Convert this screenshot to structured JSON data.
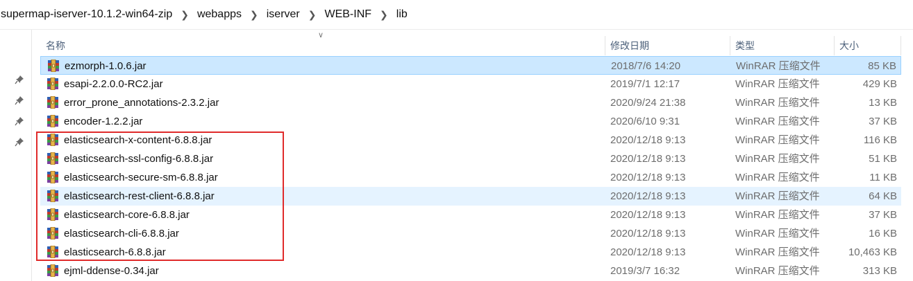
{
  "breadcrumb": [
    {
      "label": "supermap-iserver-10.1.2-win64-zip"
    },
    {
      "label": "webapps"
    },
    {
      "label": "iserver"
    },
    {
      "label": "WEB-INF"
    },
    {
      "label": "lib"
    }
  ],
  "columns": {
    "name": "名称",
    "date": "修改日期",
    "type": "类型",
    "size": "大小"
  },
  "files": [
    {
      "name": "ezmorph-1.0.6.jar",
      "date": "2018/7/6 14:20",
      "type": "WinRAR 压缩文件",
      "size": "85 KB",
      "state": "selected"
    },
    {
      "name": "esapi-2.2.0.0-RC2.jar",
      "date": "2019/7/1 12:17",
      "type": "WinRAR 压缩文件",
      "size": "429 KB",
      "state": ""
    },
    {
      "name": "error_prone_annotations-2.3.2.jar",
      "date": "2020/9/24 21:38",
      "type": "WinRAR 压缩文件",
      "size": "13 KB",
      "state": ""
    },
    {
      "name": "encoder-1.2.2.jar",
      "date": "2020/6/10 9:31",
      "type": "WinRAR 压缩文件",
      "size": "37 KB",
      "state": ""
    },
    {
      "name": "elasticsearch-x-content-6.8.8.jar",
      "date": "2020/12/18 9:13",
      "type": "WinRAR 压缩文件",
      "size": "116 KB",
      "state": ""
    },
    {
      "name": "elasticsearch-ssl-config-6.8.8.jar",
      "date": "2020/12/18 9:13",
      "type": "WinRAR 压缩文件",
      "size": "51 KB",
      "state": ""
    },
    {
      "name": "elasticsearch-secure-sm-6.8.8.jar",
      "date": "2020/12/18 9:13",
      "type": "WinRAR 压缩文件",
      "size": "11 KB",
      "state": ""
    },
    {
      "name": "elasticsearch-rest-client-6.8.8.jar",
      "date": "2020/12/18 9:13",
      "type": "WinRAR 压缩文件",
      "size": "64 KB",
      "state": "hover"
    },
    {
      "name": "elasticsearch-core-6.8.8.jar",
      "date": "2020/12/18 9:13",
      "type": "WinRAR 压缩文件",
      "size": "37 KB",
      "state": ""
    },
    {
      "name": "elasticsearch-cli-6.8.8.jar",
      "date": "2020/12/18 9:13",
      "type": "WinRAR 压缩文件",
      "size": "16 KB",
      "state": ""
    },
    {
      "name": "elasticsearch-6.8.8.jar",
      "date": "2020/12/18 9:13",
      "type": "WinRAR 压缩文件",
      "size": "10,463 KB",
      "state": ""
    },
    {
      "name": "ejml-ddense-0.34.jar",
      "date": "2019/3/7 16:32",
      "type": "WinRAR 压缩文件",
      "size": "313 KB",
      "state": ""
    }
  ],
  "icons": {
    "file": "winrar-archive-icon",
    "pin": "pin-icon",
    "breadcrumb_separator": "chevron-right-icon",
    "sort": "chevron-down-icon"
  },
  "colors": {
    "selected_bg": "#cce8ff",
    "hover_bg": "#e5f3ff",
    "highlight_border": "#e02a2a",
    "header_text": "#4c607a"
  }
}
